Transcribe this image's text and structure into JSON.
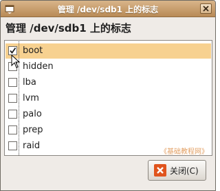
{
  "window": {
    "title": "管理 /dev/sdb1 上的标志"
  },
  "heading": "管理 /dev/sdb1 上的标志",
  "flags": [
    {
      "label": "boot",
      "checked": true,
      "selected": true
    },
    {
      "label": "hidden",
      "checked": false,
      "selected": false
    },
    {
      "label": "lba",
      "checked": false,
      "selected": false
    },
    {
      "label": "lvm",
      "checked": false,
      "selected": false
    },
    {
      "label": "palo",
      "checked": false,
      "selected": false
    },
    {
      "label": "prep",
      "checked": false,
      "selected": false
    },
    {
      "label": "raid",
      "checked": false,
      "selected": false
    }
  ],
  "watermark": "《基础教程网》",
  "buttons": {
    "close_label": "关闭(C)"
  },
  "colors": {
    "titlebar": "#c99f6e",
    "selection": "#f7d190",
    "close_icon_bg": "#e0541d",
    "watermark": "#e3a064"
  }
}
